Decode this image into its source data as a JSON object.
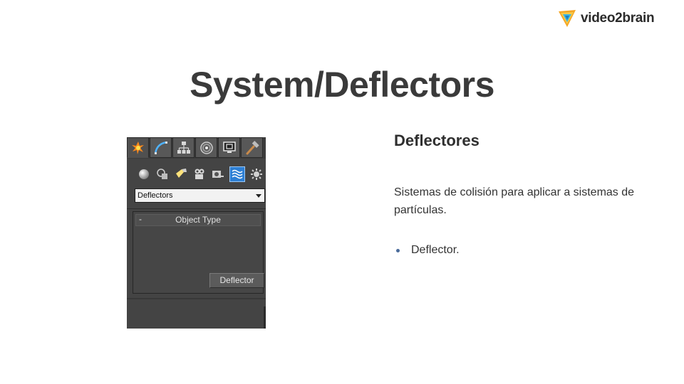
{
  "logo": {
    "text": "video2brain"
  },
  "slide": {
    "title": "System/Deflectors"
  },
  "content": {
    "heading": "Deflectores",
    "paragraph": "Sistemas de colisión para aplicar a sistemas de partículas.",
    "bullets": [
      "Deflector."
    ]
  },
  "panel": {
    "tabs": [
      "create-tab",
      "modify-tab",
      "hierarchy-tab",
      "motion-tab",
      "display-tab",
      "utilities-tab"
    ],
    "sub_icons": [
      "geometry",
      "shapes",
      "lights",
      "cameras",
      "helpers",
      "space-warps",
      "systems"
    ],
    "selected_sub_icon": "space-warps",
    "dropdown_value": "Deflectors",
    "rollout": {
      "collapse_symbol": "-",
      "title": "Object Type"
    },
    "button_label": "Deflector"
  },
  "colors": {
    "panel_bg": "#444444",
    "selected_icon": "#2d7fd4",
    "title_text": "#3a3a3a",
    "bullet_dot": "#4a6b9a"
  }
}
